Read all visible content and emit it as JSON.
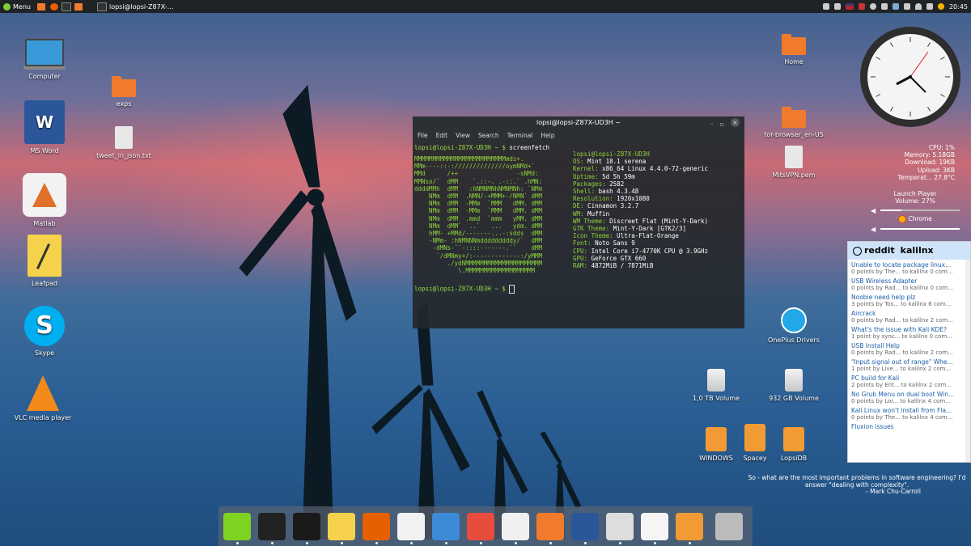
{
  "panel": {
    "menu_label": "Menu",
    "window_title": "lopsi@lopsi-Z87X-...",
    "clock": "20:45"
  },
  "desktop_left": [
    {
      "label": "Computer"
    },
    {
      "label": "MS Word"
    },
    {
      "label": "Matlab"
    },
    {
      "label": "Leafpad"
    },
    {
      "label": "Skype"
    },
    {
      "label": "VLC media player"
    }
  ],
  "desktop_center": [
    {
      "label": "exps"
    },
    {
      "label": "tweet_in_json.txt"
    }
  ],
  "desktop_right": {
    "home": "Home",
    "tor": "tor-browser_en-US",
    "vpn": "MitsVPN.pem",
    "oneplus": "OnePlus Drivers",
    "vol1": "1,0 TB Volume",
    "vol2": "932 GB Volume",
    "windows": "WINDOWS",
    "spacey": "Spacey",
    "lopsidb": "LopsiDB"
  },
  "terminal": {
    "title": "lopsi@lopsi-Z87X-UD3H ~",
    "menu": [
      "File",
      "Edit",
      "View",
      "Search",
      "Terminal",
      "Help"
    ],
    "prompt": "lopsi@lopsi-Z87X-UD3H ~ $",
    "command": " screenfetch",
    "prompt2": "lopsi@lopsi-Z87X-UD3H ~ $",
    "art": [
      "MMMMMMMMMMMMMMMMMMMMMMMMMmds+.",
      "MMm----::-://////////////oymNMd+`",
      "MMd      /++                -sNMd:",
      "MMNso/`  dMM    `.::-. .-::.` .hMN:",
      "ddddMMh  dMM   :hNMNMNhNMNMNh: `NMm",
      "    NMm  dMM  .NMN/-+MMM+-/NMN` dMM",
      "    NMm  dMM  -MMm  `MMM   dMM. dMM",
      "    NMm  dMM  -MMm  `MMM   dMM. dMM",
      "    NMm  dMM  .mmd  `mmm   yMM. dMM",
      "    NMm  dMM`  ..`   ...   ydm. dMM",
      "    hMM- +MMd/-------...-:sdds  dMM",
      "    -NMm- :hNMNNNmdddddddddy/`  dMM",
      "     -dMNs-``-::::-------.``    dMM",
      "      `/dMNmy+/:-------------:/yMMM",
      "         ./ydNMMMMMMMMMMMMMMMMMMMMM",
      "            \\.MMMMMMMMMMMMMMMMMMM"
    ],
    "info": [
      {
        "k": "",
        "v": "lopsi@lopsi-Z87X-UD3H"
      },
      {
        "k": "OS:",
        "v": " Mint 18.1 serena"
      },
      {
        "k": "Kernel:",
        "v": " x86_64 Linux 4.4.0-72-generic"
      },
      {
        "k": "Uptime:",
        "v": " 5d 5h 59m"
      },
      {
        "k": "Packages:",
        "v": " 2582"
      },
      {
        "k": "Shell:",
        "v": " bash 4.3.48"
      },
      {
        "k": "Resolution:",
        "v": " 1920x1080"
      },
      {
        "k": "DE:",
        "v": " Cinnamon 3.2.7"
      },
      {
        "k": "WM:",
        "v": " Muffin"
      },
      {
        "k": "WM Theme:",
        "v": " Discreet Flat (Mint-Y-Dark)"
      },
      {
        "k": "GTK Theme:",
        "v": " Mint-Y-Dark [GTK2/3]"
      },
      {
        "k": "Icon Theme:",
        "v": " Ultra-Flat-Orange"
      },
      {
        "k": "Font:",
        "v": " Noto Sans 9"
      },
      {
        "k": "CPU:",
        "v": " Intel Core i7-4770K CPU @ 3.9GHz"
      },
      {
        "k": "GPU:",
        "v": " GeForce GTX 660"
      },
      {
        "k": "RAM:",
        "v": " 4872MiB / 7871MiB"
      }
    ]
  },
  "sysmon": [
    "CPU: 1%",
    "Memory: 5.18GB",
    "Download: 19KB",
    "Upload: 3KB",
    "Temperat... 27.8°C"
  ],
  "media": {
    "player": "Launch Player",
    "volume_label": "Volume: 27%",
    "volume": 0.27,
    "chrome": "Chrome",
    "chrome_volume": 1.0
  },
  "reddit": {
    "header": "reddit",
    "sub": "kalilnx",
    "items": [
      {
        "title": "Unable to locate package linux...",
        "meta": "0 points by The... to kalilnx 0 com..."
      },
      {
        "title": "USB Wireless Adapter",
        "meta": "0 points by Rad... to kalilnx 0 com..."
      },
      {
        "title": "Noobie need help plz",
        "meta": "3 points by Tos... to kalilnx 6 com..."
      },
      {
        "title": "Aircrack",
        "meta": "0 points by Rad... to kalilnx 2 com..."
      },
      {
        "title": "What's the issue with Kali KDE?",
        "meta": "1 point by sync... to kalilnx 0 com..."
      },
      {
        "title": "USB Install Help",
        "meta": "0 points by Rad... to kalilnx 2 com..."
      },
      {
        "title": "\"Input signal out of range\" Whe...",
        "meta": "1 point by Live... to kalilnx 2 com..."
      },
      {
        "title": "PC build for Kali",
        "meta": "2 points by Ent... to kalilnx 2 com..."
      },
      {
        "title": "No Grub Menu on dual boot Win...",
        "meta": "0 points by Lor... to kalilnx 4 com..."
      },
      {
        "title": "Kali Linux won't install from Fla...",
        "meta": "0 points by The... to kalilnx 4 com..."
      },
      {
        "title": "Fluxion issues",
        "meta": ""
      }
    ]
  },
  "quote": {
    "text": "So - what are the most important problems in software engineering? I'd answer \"dealing with complexity\".",
    "author": "- Mark Chu-Carroll"
  },
  "dock": [
    {
      "name": "anchor-app",
      "color": "#7ed321"
    },
    {
      "name": "system-monitor-app",
      "color": "#222"
    },
    {
      "name": "terminal-app",
      "color": "#1a1a1a"
    },
    {
      "name": "leafpad-app",
      "color": "#f6d24c"
    },
    {
      "name": "firefox-app",
      "color": "#e66000"
    },
    {
      "name": "chrome-app",
      "color": "#f2f2f2"
    },
    {
      "name": "notes-app",
      "color": "#3d8bd8"
    },
    {
      "name": "picasa-app",
      "color": "#e84c3d"
    },
    {
      "name": "matlab-app",
      "color": "#f0f0f0"
    },
    {
      "name": "folder-app",
      "color": "#f07b2d"
    },
    {
      "name": "word-app",
      "color": "#2b579a"
    },
    {
      "name": "calculator-app",
      "color": "#ddd"
    },
    {
      "name": "acrobat-app",
      "color": "#f5f5f5"
    },
    {
      "name": "files-app",
      "color": "#f29b35"
    },
    {
      "name": "trash-app",
      "color": "#bbb"
    }
  ]
}
